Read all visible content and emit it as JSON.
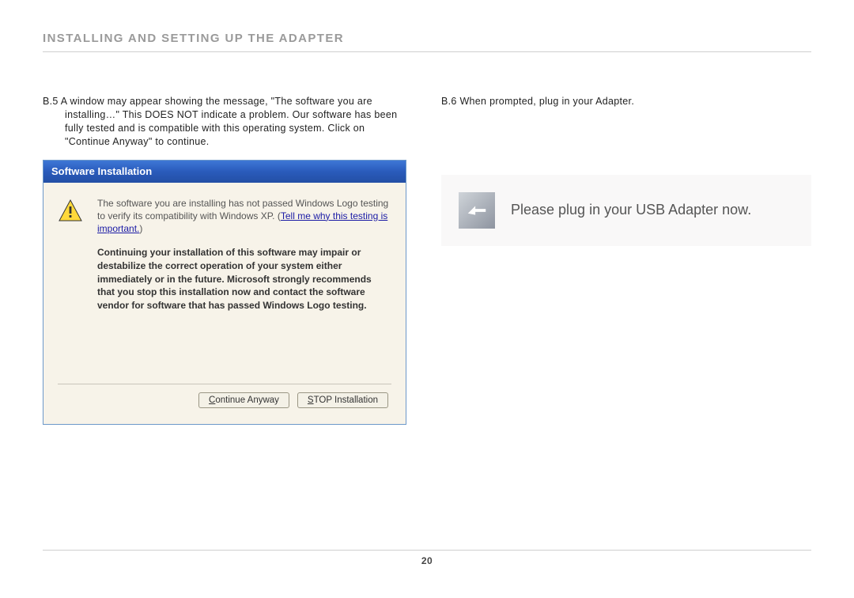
{
  "section_title": "INSTALLING AND SETTING UP THE ADAPTER",
  "left": {
    "step_label": "B.5",
    "step_body": "A window may appear showing the message, \"The software you are installing…\" This DOES NOT indicate a problem. Our software has been fully tested and is compatible with this operating system. Click on \"Continue Anyway\" to continue.",
    "dialog": {
      "title": "Software Installation",
      "line1": "The software you are installing has not passed Windows Logo testing to verify its compatibility with Windows XP. (",
      "link": "Tell me why this testing is important.",
      "line1_close": ")",
      "caution": "Continuing your installation of this software may impair or destabilize the correct operation of your system either immediately or in the future. Microsoft strongly recommends that you stop this installation now and contact the software vendor for software that has passed Windows Logo testing.",
      "continue_prefix": "C",
      "continue_rest": "ontinue Anyway",
      "stop_prefix": "S",
      "stop_rest": "TOP Installation"
    }
  },
  "right": {
    "step_label": "B.6",
    "step_body": "When prompted, plug in your Adapter.",
    "panel_text": "Please plug in your USB Adapter now."
  },
  "page_number": "20"
}
